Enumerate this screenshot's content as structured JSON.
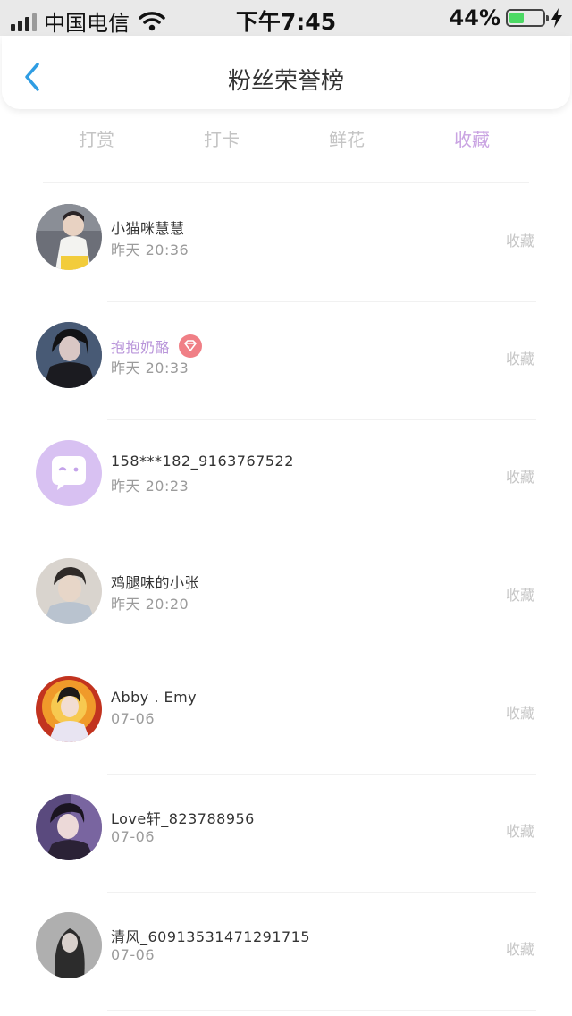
{
  "status_bar": {
    "carrier": "中国电信",
    "time": "下午7:45",
    "battery_percent": "44%",
    "battery_level": 0.44,
    "battery_color": "#4cd964"
  },
  "nav": {
    "title": "粉丝荣誉榜",
    "back_icon": "chevron-left-icon",
    "back_color": "#2f9de3"
  },
  "tabs": [
    {
      "label": "打赏",
      "active": false
    },
    {
      "label": "打卡",
      "active": false
    },
    {
      "label": "鲜花",
      "active": false
    },
    {
      "label": "收藏",
      "active": true
    }
  ],
  "accent_color": "#c9a3e2",
  "fans": [
    {
      "name": "小猫咪慧慧",
      "time": "昨天 20:36",
      "action": "收藏",
      "vip": false
    },
    {
      "name": "抱抱奶酪",
      "time": "昨天 20:33",
      "action": "收藏",
      "vip": true
    },
    {
      "name": "158***182_9163767522",
      "time": "昨天 20:23",
      "action": "收藏",
      "vip": false
    },
    {
      "name": "鸡腿味的小张",
      "time": "昨天 20:20",
      "action": "收藏",
      "vip": false
    },
    {
      "name": "Abby . Emy",
      "time": "07-06",
      "action": "收藏",
      "vip": false
    },
    {
      "name": "Love轩_823788956",
      "time": "07-06",
      "action": "收藏",
      "vip": false
    },
    {
      "name": "清风_60913531471291715",
      "time": "07-06",
      "action": "收藏",
      "vip": false
    }
  ]
}
